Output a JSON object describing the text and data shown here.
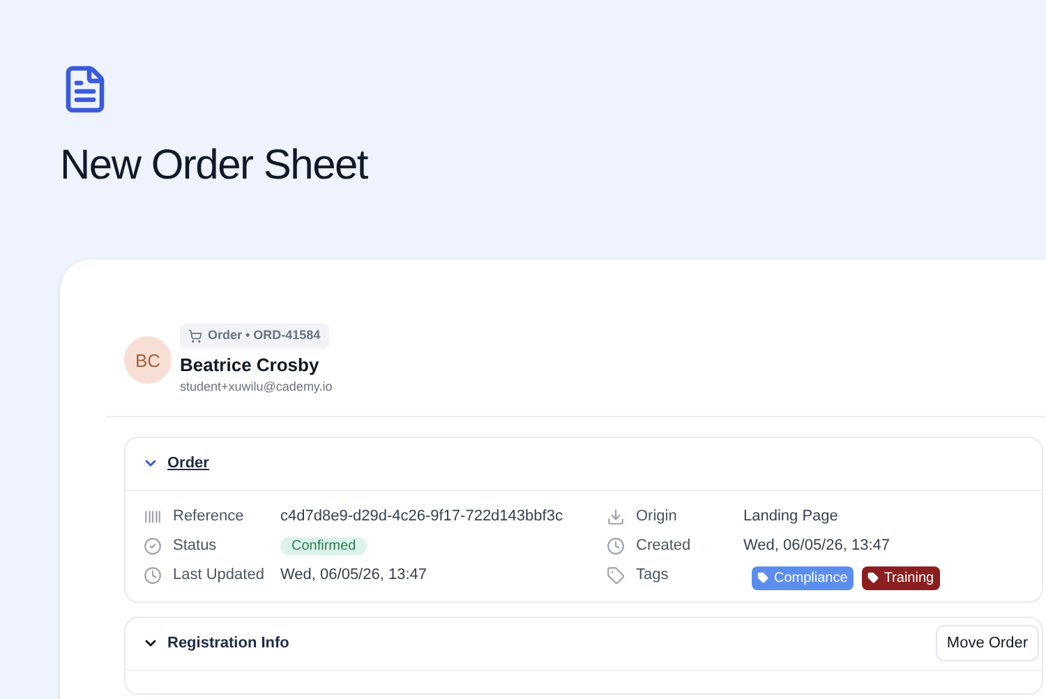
{
  "page": {
    "title": "New Order Sheet"
  },
  "record": {
    "avatar_initials": "BC",
    "badge": "Order • ORD-41584",
    "name": "Beatrice Crosby",
    "email": "student+xuwilu@cademy.io"
  },
  "sections": [
    {
      "title": "Order",
      "expanded": true,
      "link": true,
      "fields_left": [
        {
          "kind": "text",
          "label": "Reference",
          "value": "c4d7d8e9-d29d-4c26-9f17-722d143bbf3c"
        },
        {
          "kind": "status",
          "label": "Status",
          "value": "Confirmed"
        },
        {
          "kind": "text",
          "label": "Last Updated",
          "value": "Wed, 06/05/26, 13:47"
        }
      ],
      "fields_right": [
        {
          "kind": "text",
          "label": "Origin",
          "value": "Landing Page"
        },
        {
          "kind": "text",
          "label": "Created",
          "value": "Wed, 06/05/26, 13:47"
        },
        {
          "kind": "tags",
          "label": "Tags",
          "tags": [
            {
              "label": "Compliance",
              "color": "#5b8def"
            },
            {
              "label": "Training",
              "color": "#8b1f1f"
            }
          ]
        }
      ]
    },
    {
      "title": "Registration Info",
      "expanded": true,
      "link": false,
      "action": "Move Order"
    }
  ]
}
